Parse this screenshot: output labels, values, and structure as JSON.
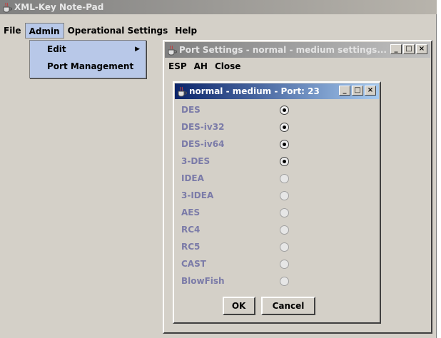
{
  "app": {
    "title": "XML-Key Note-Pad"
  },
  "menubar": {
    "items": [
      {
        "label": "File"
      },
      {
        "label": "Admin"
      },
      {
        "label": "Operational Settings"
      },
      {
        "label": "Help"
      }
    ]
  },
  "admin_menu": {
    "items": [
      {
        "label": "Edit",
        "submenu_arrow": "▶"
      },
      {
        "label": "Port Management"
      }
    ]
  },
  "port_window": {
    "title": "Port Settings - normal - medium settings...",
    "menu": [
      {
        "label": "ESP"
      },
      {
        "label": "AH"
      },
      {
        "label": "Close"
      }
    ],
    "controls": {
      "minimize": "_",
      "maximize": "□",
      "close": "×"
    }
  },
  "inner_window": {
    "title": "normal - medium - Port: 23",
    "controls": {
      "minimize": "_",
      "maximize": "□",
      "close": "×"
    },
    "options": [
      {
        "label": "DES",
        "selected": true
      },
      {
        "label": "DES-iv32",
        "selected": true
      },
      {
        "label": "DES-iv64",
        "selected": true
      },
      {
        "label": "3-DES",
        "selected": true
      },
      {
        "label": "IDEA",
        "selected": false
      },
      {
        "label": "3-IDEA",
        "selected": false
      },
      {
        "label": "AES",
        "selected": false
      },
      {
        "label": "RC4",
        "selected": false
      },
      {
        "label": "RC5",
        "selected": false
      },
      {
        "label": "CAST",
        "selected": false
      },
      {
        "label": "BlowFish",
        "selected": false
      }
    ],
    "buttons": {
      "ok": "OK",
      "cancel": "Cancel"
    }
  },
  "colors": {
    "active_title": "#0a246a",
    "inactive_title": "#808080",
    "option_text": "#7b7ba8",
    "menu_highlight": "#b8c8e8"
  }
}
